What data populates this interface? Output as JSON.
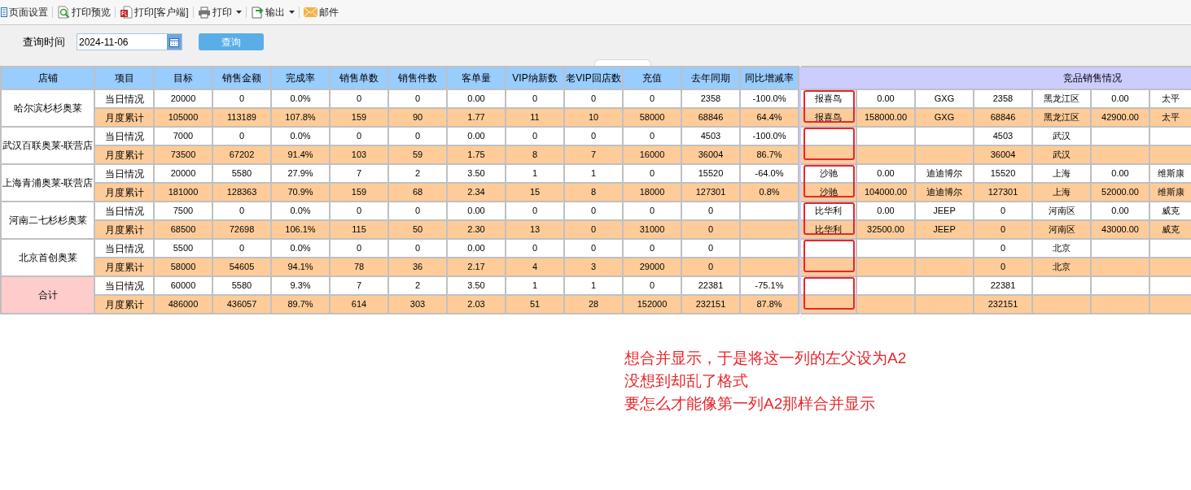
{
  "toolbar": [
    {
      "kind": "setup",
      "label": "页面设置",
      "dropdown": false
    },
    {
      "kind": "preview",
      "label": "打印预览",
      "dropdown": false
    },
    {
      "kind": "client",
      "label": "打印[客户端]",
      "dropdown": false
    },
    {
      "kind": "print",
      "label": "打印",
      "dropdown": true
    },
    {
      "kind": "export",
      "label": "输出",
      "dropdown": true
    },
    {
      "kind": "mail",
      "label": "邮件",
      "dropdown": false
    }
  ],
  "query": {
    "label": "查询时间",
    "date": "2024-11-06",
    "button": "查询"
  },
  "table": {
    "columns": [
      "店铺",
      "项目",
      "目标",
      "销售金额",
      "完成率",
      "销售单数",
      "销售件数",
      "客单量",
      "VIP纳新数",
      "老VIP回店数",
      "充值",
      "去年同期",
      "同比增减率"
    ],
    "competitor_header": "竞品销售情况",
    "groups": [
      {
        "kind": "store",
        "store": "哈尔滨杉杉奥莱",
        "annotated": true,
        "rows": [
          {
            "item": "当日情况",
            "values": [
              "20000",
              "0",
              "0.0%",
              "0",
              "0",
              "0.00",
              "0",
              "0",
              "0",
              "2358"
            ],
            "yoy_change": "-100.0%",
            "competitors": {
              "column_1": "报喜鸟",
              "column_2": "0.00",
              "column_3": "GXG",
              "column_4": "2358",
              "column_5": "黑龙江区",
              "column_6": "0.00",
              "column_7": "太平"
            }
          },
          {
            "item": "月度累计",
            "values": [
              "105000",
              "113189",
              "107.8%",
              "159",
              "90",
              "1.77",
              "11",
              "10",
              "58000",
              "68846"
            ],
            "yoy_change": "64.4%",
            "competitors": {
              "column_1": "报喜鸟",
              "column_2": "158000.00",
              "column_3": "GXG",
              "column_4": "68846",
              "column_5": "黑龙江区",
              "column_6": "42900.00",
              "column_7": "太平"
            }
          }
        ]
      },
      {
        "kind": "store",
        "store": "武汉百联奥莱-联营店",
        "annotated": true,
        "rows": [
          {
            "item": "当日情况",
            "values": [
              "7000",
              "0",
              "0.0%",
              "0",
              "0",
              "0.00",
              "0",
              "0",
              "0",
              "4503"
            ],
            "yoy_change": "-100.0%",
            "competitors": {
              "column_4": "4503",
              "column_5": "武汉"
            }
          },
          {
            "item": "月度累计",
            "values": [
              "73500",
              "67202",
              "91.4%",
              "103",
              "59",
              "1.75",
              "8",
              "7",
              "16000",
              "36004"
            ],
            "yoy_change": "86.7%",
            "competitors": {
              "column_4": "36004",
              "column_5": "武汉"
            }
          }
        ]
      },
      {
        "kind": "store",
        "store": "上海青浦奥莱-联营店",
        "annotated": true,
        "rows": [
          {
            "item": "当日情况",
            "values": [
              "20000",
              "5580",
              "27.9%",
              "7",
              "2",
              "3.50",
              "1",
              "1",
              "0",
              "15520"
            ],
            "yoy_change": "-64.0%",
            "competitors": {
              "column_1": "沙驰",
              "column_2": "0.00",
              "column_3": "迪迪博尔",
              "column_4": "15520",
              "column_5": "上海",
              "column_6": "0.00",
              "column_7": "维斯康"
            }
          },
          {
            "item": "月度累计",
            "values": [
              "181000",
              "128363",
              "70.9%",
              "159",
              "68",
              "2.34",
              "15",
              "8",
              "18000",
              "127301"
            ],
            "yoy_change": "0.8%",
            "competitors": {
              "column_1": "沙驰",
              "column_2": "104000.00",
              "column_3": "迪迪博尔",
              "column_4": "127301",
              "column_5": "上海",
              "column_6": "52000.00",
              "column_7": "维斯康"
            }
          }
        ]
      },
      {
        "kind": "store",
        "store": "河南二七杉杉奥莱",
        "annotated": true,
        "rows": [
          {
            "item": "当日情况",
            "values": [
              "7500",
              "0",
              "0.0%",
              "0",
              "0",
              "0.00",
              "0",
              "0",
              "0",
              "0"
            ],
            "competitors": {
              "column_1": "比华利",
              "column_2": "0.00",
              "column_3": "JEEP",
              "column_4": "0",
              "column_5": "河南区",
              "column_6": "0.00",
              "column_7": "威克"
            }
          },
          {
            "item": "月度累计",
            "values": [
              "68500",
              "72698",
              "106.1%",
              "115",
              "50",
              "2.30",
              "13",
              "0",
              "31000",
              "0"
            ],
            "competitors": {
              "column_1": "比华利",
              "column_2": "32500.00",
              "column_3": "JEEP",
              "column_4": "0",
              "column_5": "河南区",
              "column_6": "43000.00",
              "column_7": "威克"
            }
          }
        ]
      },
      {
        "kind": "store",
        "store": "北京首创奥莱",
        "annotated": true,
        "rows": [
          {
            "item": "当日情况",
            "values": [
              "5500",
              "0",
              "0.0%",
              "0",
              "0",
              "0.00",
              "0",
              "0",
              "0",
              "0"
            ],
            "competitors": {
              "column_4": "0",
              "column_5": "北京"
            }
          },
          {
            "item": "月度累计",
            "values": [
              "58000",
              "54605",
              "94.1%",
              "78",
              "36",
              "2.17",
              "4",
              "3",
              "29000",
              "0"
            ],
            "competitors": {
              "column_4": "0",
              "column_5": "北京"
            }
          }
        ]
      },
      {
        "kind": "total",
        "store": "合计",
        "annotated": true,
        "rows": [
          {
            "item": "当日情况",
            "values": [
              "60000",
              "5580",
              "9.3%",
              "7",
              "2",
              "3.50",
              "1",
              "1",
              "0",
              "22381"
            ],
            "yoy_change": "-75.1%",
            "competitors": {
              "column_4": "22381"
            }
          },
          {
            "item": "月度累计",
            "values": [
              "486000",
              "436057",
              "89.7%",
              "614",
              "303",
              "2.03",
              "51",
              "28",
              "152000",
              "232151"
            ],
            "yoy_change": "87.8%",
            "competitors": {
              "column_4": "232151"
            }
          }
        ]
      }
    ]
  },
  "note": [
    "想合并显示，于是将这一列的左父设为A2",
    "没想到却乱了格式",
    "要怎么才能像第一列A2那样合并显示"
  ]
}
